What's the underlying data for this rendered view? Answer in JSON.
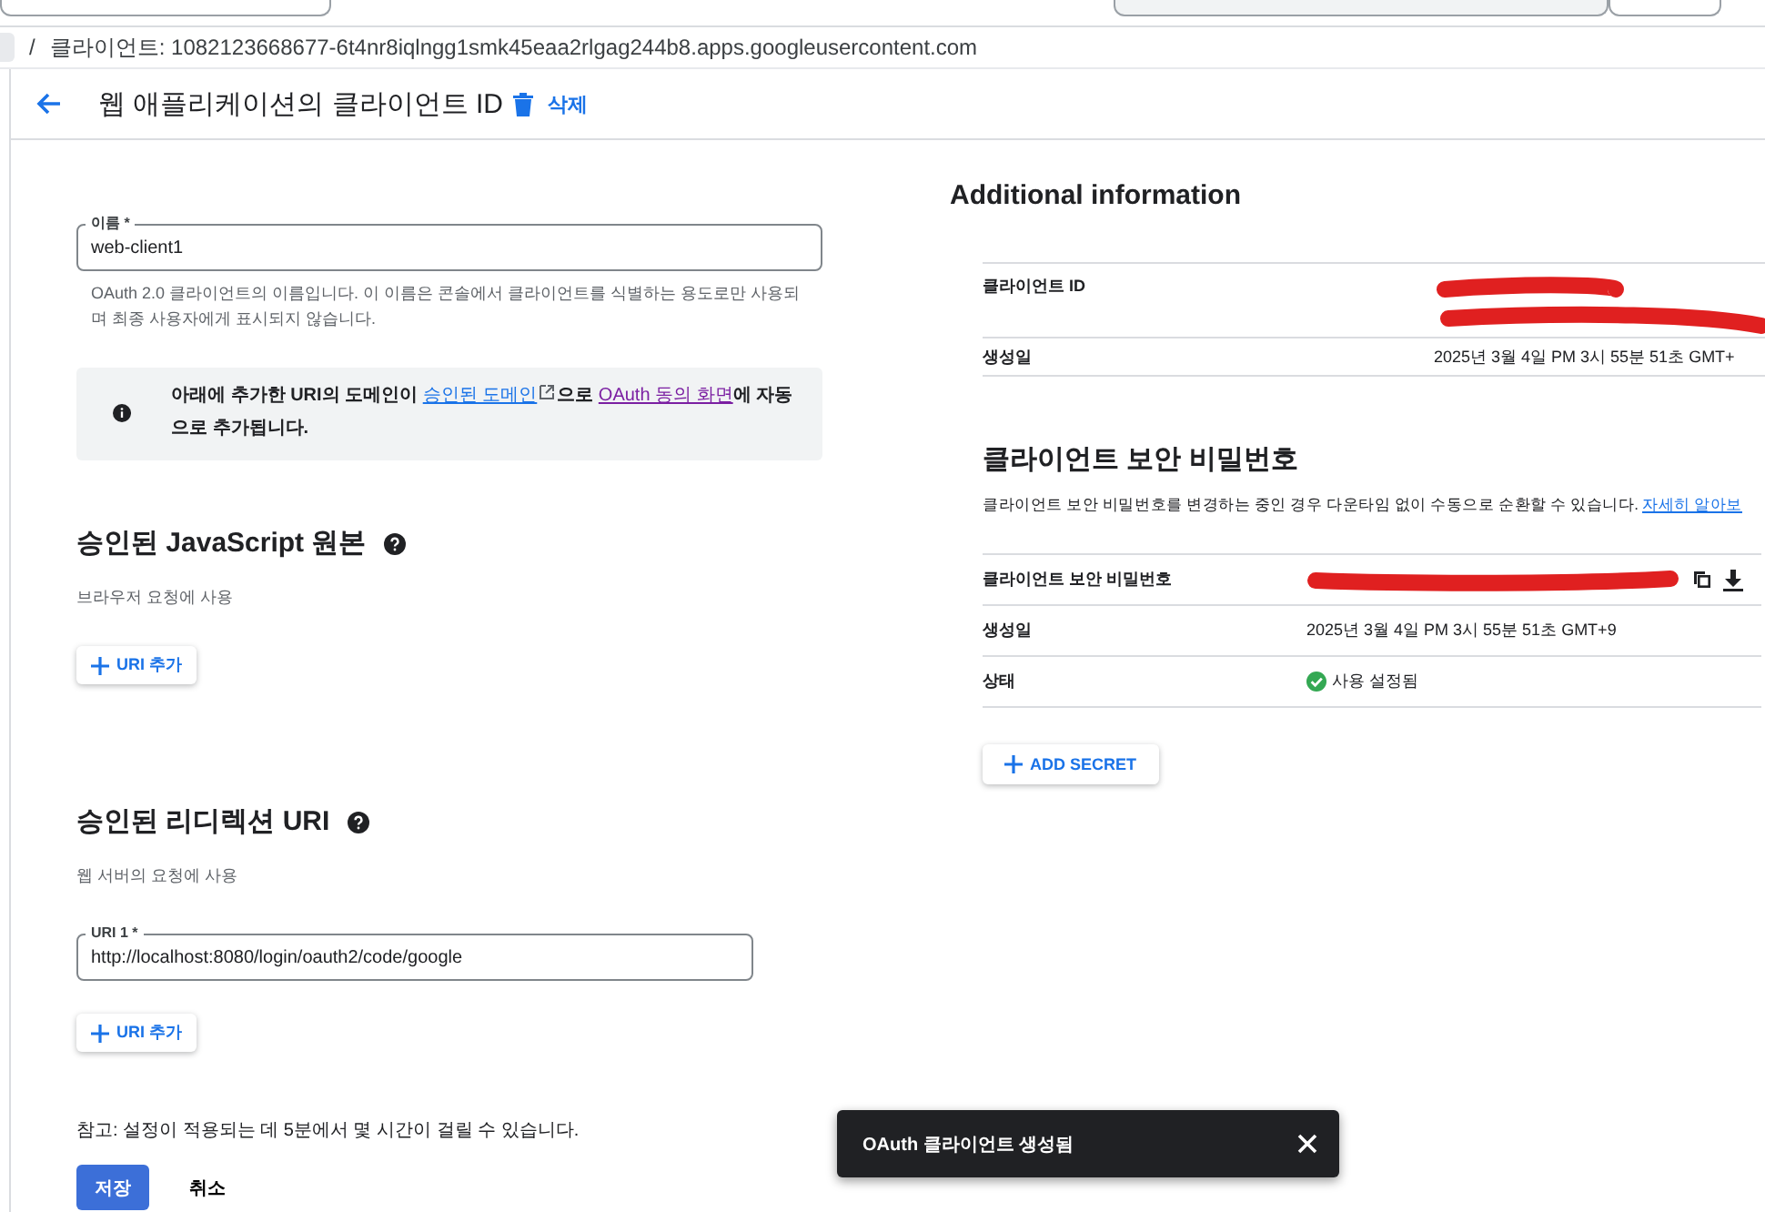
{
  "breadcrumb": {
    "separator": "/",
    "label": "클라이언트:",
    "value": "1082123668677-6t4nr8iqlngg1smk45eaa2rlgag244b8.apps.googleusercontent.com"
  },
  "header": {
    "title": "웹 애플리케이션의 클라이언트 ID",
    "delete_label": "삭제"
  },
  "name_field": {
    "label": "이름 *",
    "value": "web-client1",
    "helper": "OAuth 2.0 클라이언트의 이름입니다. 이 이름은 콘솔에서 클라이언트를 식별하는 용도로만 사용되며 최종 사용자에게 표시되지 않습니다."
  },
  "info_notice": {
    "before": "아래에 추가한 URI의 도메인이 ",
    "link1": "승인된 도메인",
    "middle": "으로 ",
    "link2": "OAuth 동의 화면",
    "after": "에 자동으로 추가됩니다."
  },
  "sections": [
    {
      "title": "승인된 JavaScript 원본",
      "subtitle": "브라우저 요청에 사용",
      "add_label": "URI 추가"
    },
    {
      "title": "승인된 리디렉션 URI",
      "subtitle": "웹 서버의 요청에 사용",
      "fields": [
        {
          "label": "URI 1 *",
          "value": "http://localhost:8080/login/oauth2/code/google"
        }
      ],
      "add_label": "URI 추가"
    }
  ],
  "note": "참고: 설정이 적용되는 데 5분에서 몇 시간이 걸릴 수 있습니다.",
  "save_label": "저장",
  "cancel_label": "취소",
  "additional": {
    "title": "Additional information",
    "rows": [
      {
        "label": "클라이언트 ID",
        "kind": "redacted"
      },
      {
        "label": "생성일",
        "kind": "text",
        "value": "2025년 3월 4일 PM 3시 55분 51초 GMT+"
      }
    ],
    "secret_title": "클라이언트 보안 비밀번호",
    "secret_desc": "클라이언트 보안 비밀번호를 변경하는 중인 경우 다운타임 없이 수동으로 순환할 수 있습니다. ",
    "secret_link": "자세히 알아보",
    "secret_rows": [
      {
        "label": "클라이언트 보안 비밀번호",
        "kind": "secret"
      },
      {
        "label": "생성일",
        "kind": "text",
        "value": "2025년 3월 4일 PM 3시 55분 51초 GMT+9"
      },
      {
        "label": "상태",
        "kind": "status",
        "value": "사용 설정됨",
        "enabled": true
      }
    ],
    "add_secret": "ADD SECRET"
  },
  "toast": {
    "message": "OAuth 클라이언트 생성됨"
  }
}
